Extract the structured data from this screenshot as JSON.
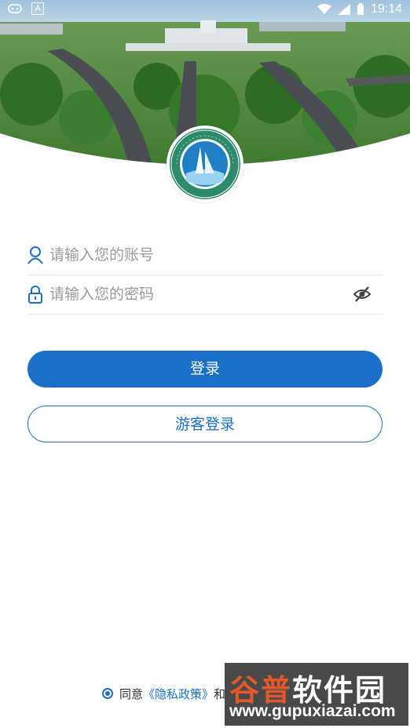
{
  "status_bar": {
    "time": "19:14",
    "badge": "A"
  },
  "colors": {
    "accent": "#1a6fc9",
    "sky": "#8fb6d6",
    "grass": "#4d8f3a"
  },
  "login_form": {
    "account_placeholder": "请输入您的账号",
    "password_placeholder": "请输入您的密码",
    "login_label": "登录",
    "guest_label": "游客登录"
  },
  "agreement": {
    "prefix": "同意",
    "privacy_link": "《隐私政策》",
    "suffix": "和"
  },
  "watermark": {
    "brand_a": "谷普",
    "brand_b": "软件园",
    "url": "www.gupuxiazai.com"
  }
}
